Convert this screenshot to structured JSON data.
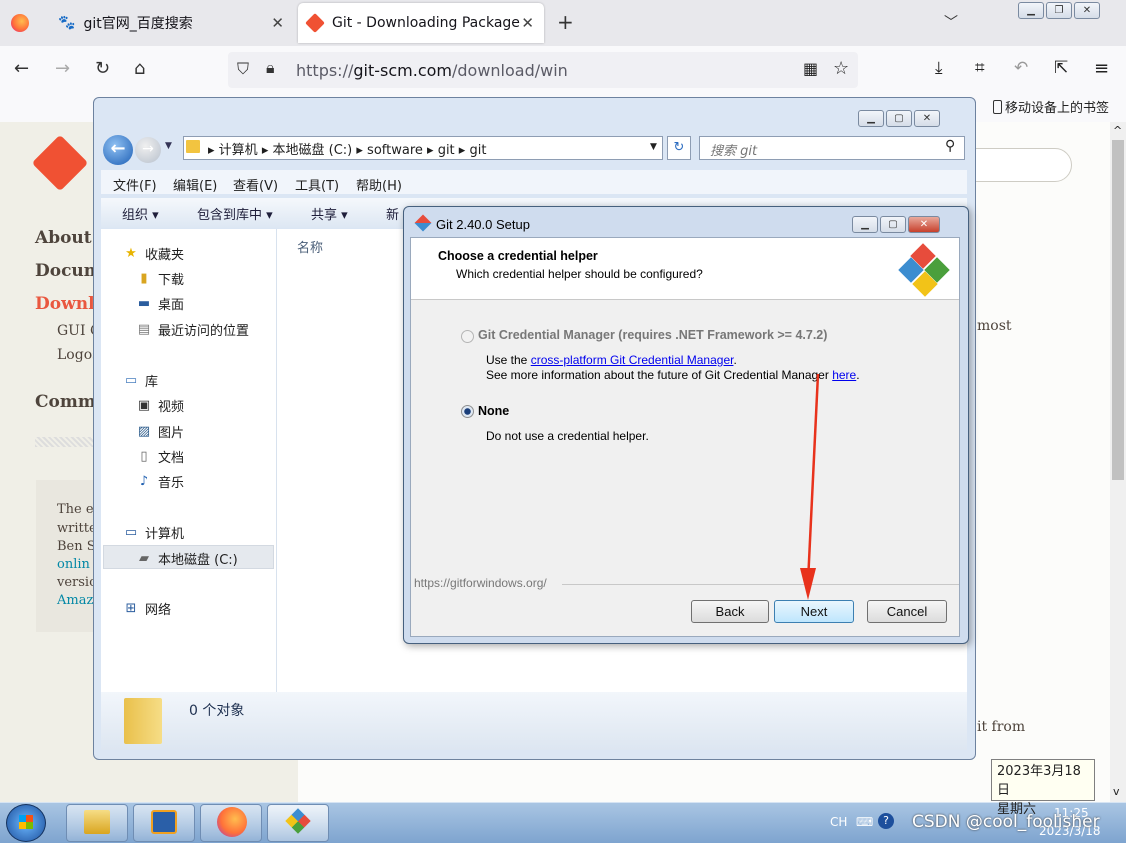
{
  "browser": {
    "tabs": [
      {
        "title": "git官网_百度搜索"
      },
      {
        "title": "Git - Downloading Package"
      }
    ],
    "url_prefix": "https://",
    "url_domain": "git-scm.com",
    "url_path": "/download/win",
    "mobile_bookmarks": "移动设备上的书签"
  },
  "page": {
    "side": [
      "About",
      "Docum",
      "Downl",
      "Comm"
    ],
    "side_sub": [
      "GUI C",
      "Logos"
    ],
    "box_lines": [
      "The e",
      "writte",
      "Ben S",
      "onlin",
      "versio",
      "Amaz"
    ],
    "right_text_1": "most",
    "right_text_2": "it from"
  },
  "explorer": {
    "crumbs": [
      "计算机",
      "本地磁盘 (C:)",
      "software",
      "git",
      "git"
    ],
    "search_placeholder": "搜索 git",
    "menu": [
      "文件(F)",
      "编辑(E)",
      "查看(V)",
      "工具(T)",
      "帮助(H)"
    ],
    "commands": [
      "组织 ▾",
      "包含到库中 ▾",
      "共享 ▾",
      "新"
    ],
    "nav": {
      "favorites": "收藏夹",
      "downloads": "下载",
      "desktop": "桌面",
      "recent": "最近访问的位置",
      "libraries": "库",
      "videos": "视频",
      "pictures": "图片",
      "documents": "文档",
      "music": "音乐",
      "computer": "计算机",
      "local_disk": "本地磁盘 (C:)",
      "network": "网络"
    },
    "column_name": "名称",
    "status_count": "0 个对象"
  },
  "setup": {
    "title": "Git 2.40.0 Setup",
    "heading": "Choose a credential helper",
    "subheading": "Which credential helper should be configured?",
    "option1_label": "Git Credential Manager (requires .NET Framework >= 4.7.2)",
    "option1_desc_pre": "Use the ",
    "option1_desc_link": "cross-platform Git Credential Manager",
    "option1_desc_post": ".",
    "option1_more_pre": "See more information about the future of Git Credential Manager ",
    "option1_more_link": "here",
    "option1_more_post": ".",
    "option2_label": "None",
    "option2_desc": "Do not use a credential helper.",
    "footer_url": "https://gitforwindows.org/",
    "back": "Back",
    "next": "Next",
    "cancel": "Cancel",
    "selected": "None"
  },
  "taskbar": {
    "lang": "CH",
    "time": "11:25",
    "date": "2023/3/18",
    "watermark": "CSDN @cool_foolisher"
  },
  "tooltip": {
    "line1": "2023年3月18日",
    "line2": "星期六"
  },
  "colors": {
    "arrow": "#e8321c",
    "git_logo": "#f05133"
  }
}
